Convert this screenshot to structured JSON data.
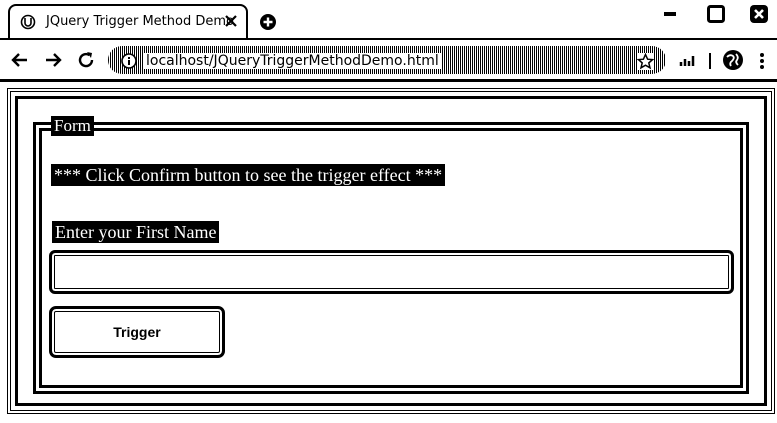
{
  "browser": {
    "tab_title": "JQuery Trigger Method Demo",
    "url": "localhost/JQueryTriggerMethodDemo.html",
    "icons": [
      "favicon-icon",
      "close-icon",
      "new-tab-icon",
      "minimize-icon",
      "maximize-icon",
      "window-close-icon",
      "back-icon",
      "forward-icon",
      "reload-icon",
      "info-icon",
      "star-icon",
      "tab-search-icon",
      "profile-icon"
    ]
  },
  "page": {
    "legend": "Form",
    "heading": "*** Click Confirm button to see the trigger effect ***",
    "input_label": "Enter your First Name",
    "input_value": "",
    "input_placeholder": "",
    "button_label": "Trigger"
  }
}
